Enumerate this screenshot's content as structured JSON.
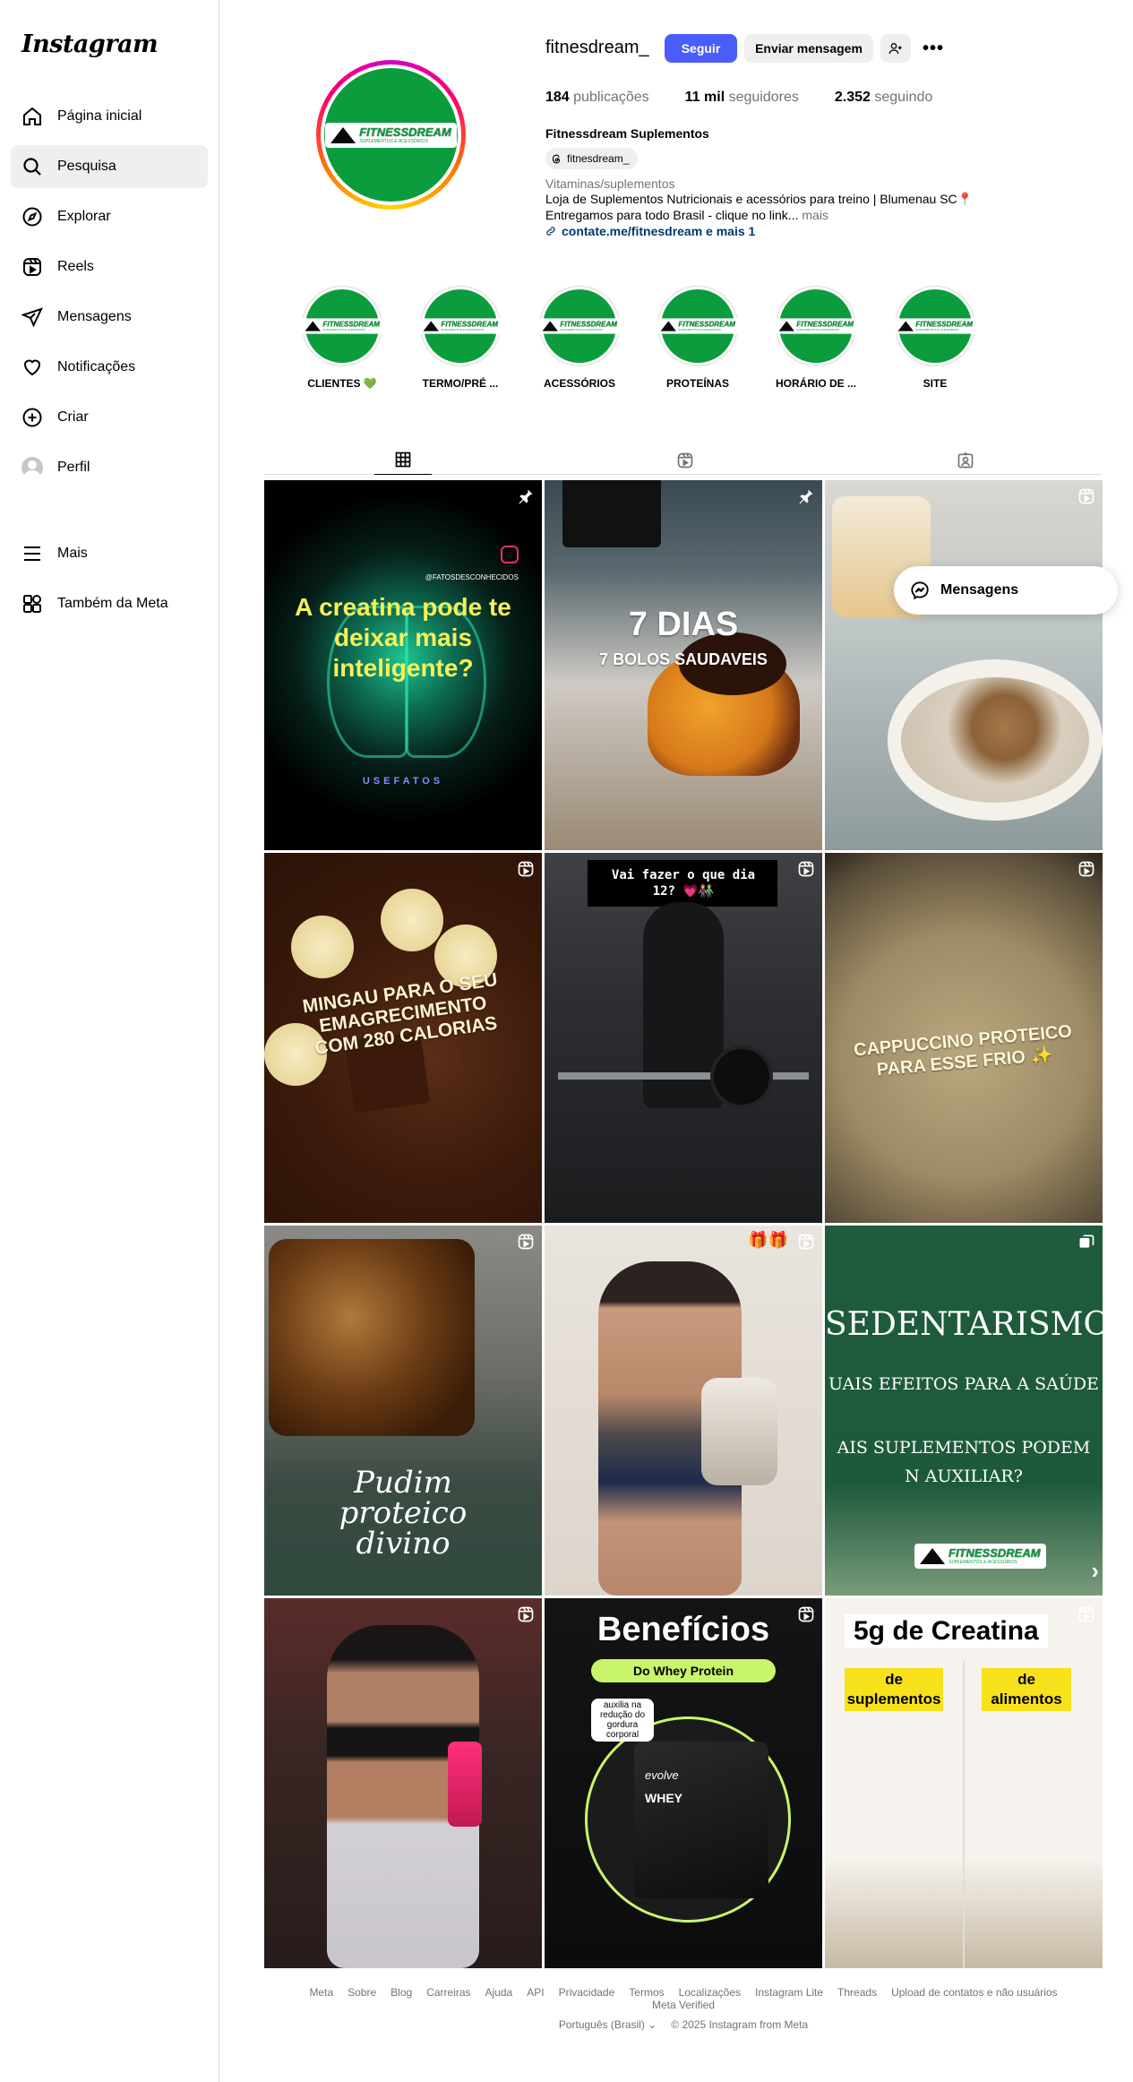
{
  "app": {
    "logo": "Instagram"
  },
  "sidebar": {
    "items": [
      {
        "label": "Página inicial",
        "icon": "home-icon"
      },
      {
        "label": "Pesquisa",
        "icon": "search-icon",
        "active": true
      },
      {
        "label": "Explorar",
        "icon": "compass-icon"
      },
      {
        "label": "Reels",
        "icon": "reels-icon"
      },
      {
        "label": "Mensagens",
        "icon": "send-icon"
      },
      {
        "label": "Notificações",
        "icon": "heart-icon"
      },
      {
        "label": "Criar",
        "icon": "plus-square-icon"
      },
      {
        "label": "Perfil",
        "icon": "avatar"
      }
    ],
    "more": "Mais",
    "meta": "Também da Meta"
  },
  "profile": {
    "username": "fitnesdream_",
    "follow_label": "Seguir",
    "message_label": "Enviar mensagem",
    "more_label": "•••",
    "stats": {
      "posts_value": "184",
      "posts_label": "publicações",
      "followers_value": "11 mil",
      "followers_label": "seguidores",
      "following_value": "2.352",
      "following_label": "seguindo"
    },
    "full_name": "Fitnessdream Suplementos",
    "threads_handle": "fitnesdream_",
    "category": "Vitaminas/suplementos",
    "bio_line1": "Loja de Suplementos Nutricionais e acessórios para treino | Blumenau SC📍",
    "bio_line2": "Entregamos para todo Brasil - clique no link...",
    "bio_more": "mais",
    "link": "contate.me/fitnesdream e mais 1",
    "brand_title": "FITNESSDREAM",
    "brand_sub": "SUPLEMENTOS E ACESSÓRIOS"
  },
  "highlights": [
    {
      "label": "CLIENTES 💚"
    },
    {
      "label": "TERMO/PRÉ ..."
    },
    {
      "label": "ACESSÓRIOS"
    },
    {
      "label": "PROTEÍNAS"
    },
    {
      "label": "HORÁRIO DE ..."
    },
    {
      "label": "SITE"
    }
  ],
  "tabs": [
    {
      "name": "posts",
      "icon": "grid-icon",
      "active": true
    },
    {
      "name": "reels",
      "icon": "reels-icon"
    },
    {
      "name": "tagged",
      "icon": "tagged-icon"
    }
  ],
  "posts": {
    "p1": {
      "title": "A creatina pode te deixar mais inteligente?",
      "handle": "@FATOSDESCONHECIDOS",
      "footer": "USEFATOS",
      "badge": "pin-icon"
    },
    "p2": {
      "title": "7 DIAS",
      "subtitle": "7 BOLOS SAUDAVEIS",
      "badge": "pin-icon"
    },
    "p3": {
      "badge": "reel-icon"
    },
    "p4": {
      "title": "MINGAU PARA O SEU EMAGRECIMENTO COM 280 CALORIAS",
      "badge": "reel-icon"
    },
    "p5": {
      "title": "Vai fazer o que dia 12? 💗👫",
      "badge": "reel-icon"
    },
    "p6": {
      "title": "CAPPUCCINO PROTEICO PARA ESSE FRIO ✨",
      "badge": "reel-icon"
    },
    "p7": {
      "title": "Pudim proteico divino",
      "badge": "reel-icon"
    },
    "p8": {
      "emoji": "🎁🎁",
      "badge": "reel-icon"
    },
    "p9": {
      "title": "SEDENTARISMO:",
      "line2": "UAIS EFEITOS PARA A SAÚDE",
      "line3": "AIS SUPLEMENTOS PODEM N AUXILIAR?",
      "badge": "carousel-icon"
    },
    "p10": {
      "badge": "reel-icon"
    },
    "p11": {
      "title": "Benefícios",
      "pill": "Do Whey Protein",
      "bubble": "auxilia na redução do gordura corporal",
      "brand": "evolve",
      "product": "WHEY",
      "badge": "reel-icon"
    },
    "p12": {
      "title": "5g de Creatina",
      "left_label": "de suplementos",
      "right_label": "de alimentos",
      "badge": "reel-icon"
    }
  },
  "messages_float": {
    "label": "Mensagens"
  },
  "footer": {
    "links": [
      "Meta",
      "Sobre",
      "Blog",
      "Carreiras",
      "Ajuda",
      "API",
      "Privacidade",
      "Termos",
      "Localizações",
      "Instagram Lite",
      "Threads",
      "Upload de contatos e não usuários",
      "Meta Verified"
    ],
    "language": "Português (Brasil)",
    "copyright": "© 2025 Instagram from Meta"
  },
  "colors": {
    "brand_green": "#0b9d3d",
    "follow_blue": "#4a5df9",
    "link_blue": "#00376b"
  }
}
